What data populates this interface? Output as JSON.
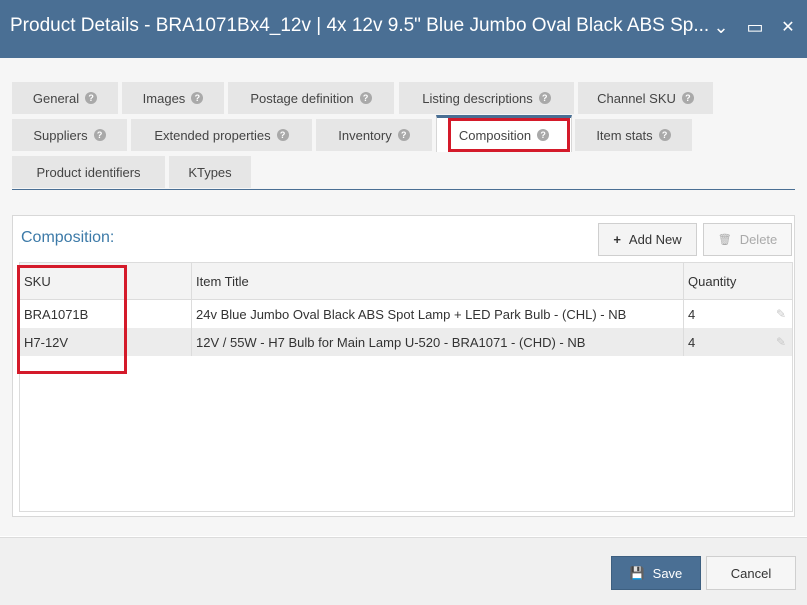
{
  "window": {
    "title": "Product Details - BRA1071Bx4_12v | 4x 12v 9.5\" Blue Jumbo Oval Black ABS Sp...",
    "minimize_glyph": "⌄",
    "maximize_glyph": "▭",
    "close_glyph": "✕"
  },
  "tabs": [
    {
      "label": "General"
    },
    {
      "label": "Images"
    },
    {
      "label": "Postage definition"
    },
    {
      "label": "Listing descriptions"
    },
    {
      "label": "Channel SKU"
    },
    {
      "label": "Suppliers"
    },
    {
      "label": "Extended properties"
    },
    {
      "label": "Inventory"
    },
    {
      "label": "Composition"
    },
    {
      "label": "Item stats"
    },
    {
      "label": "Product identifiers"
    },
    {
      "label": "KTypes"
    }
  ],
  "help_glyph": "?",
  "active_tab": "Composition",
  "panel": {
    "title": "Composition:",
    "add_new_label": "Add New",
    "delete_label": "Delete",
    "add_icon": "+",
    "delete_icon": "🗑"
  },
  "table": {
    "columns": [
      "SKU",
      "Item Title",
      "Quantity"
    ],
    "rows": [
      {
        "sku": "BRA1071B",
        "title": "24v Blue Jumbo Oval Black ABS Spot Lamp + LED Park Bulb - (CHL) - NB",
        "qty": "4"
      },
      {
        "sku": "H7-12V",
        "title": "12V / 55W - H7 Bulb for Main Lamp U-520 - BRA1071 - (CHD) - NB",
        "qty": "4"
      }
    ]
  },
  "footer": {
    "save_label": "Save",
    "cancel_label": "Cancel",
    "save_icon": "💾"
  },
  "colors": {
    "accent": "#4a6f94",
    "highlight": "#d41a2a",
    "panel_title": "#3c7aa8"
  }
}
